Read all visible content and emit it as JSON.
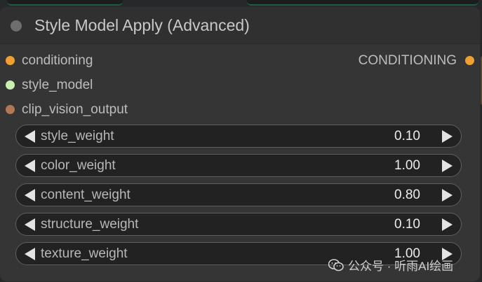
{
  "node": {
    "title": "Style Model Apply (Advanced)",
    "inputs": [
      {
        "label": "conditioning",
        "color": "#f0a030"
      },
      {
        "label": "style_model",
        "color": "#c8f0b0"
      },
      {
        "label": "clip_vision_output",
        "color": "#b07855"
      }
    ],
    "output": {
      "label": "CONDITIONING",
      "color": "#f0a030"
    },
    "widgets": [
      {
        "label": "style_weight",
        "value": "0.10"
      },
      {
        "label": "color_weight",
        "value": "1.00"
      },
      {
        "label": "content_weight",
        "value": "0.80"
      },
      {
        "label": "structure_weight",
        "value": "0.10"
      },
      {
        "label": "texture_weight",
        "value": "1.00"
      }
    ]
  },
  "watermark": {
    "text": "公众号 · 听雨AI绘画",
    "icon": "wechat-icon"
  },
  "colors": {
    "node_bg": "#353535",
    "widget_bg": "#222222",
    "canvas_bg": "#26282a"
  }
}
